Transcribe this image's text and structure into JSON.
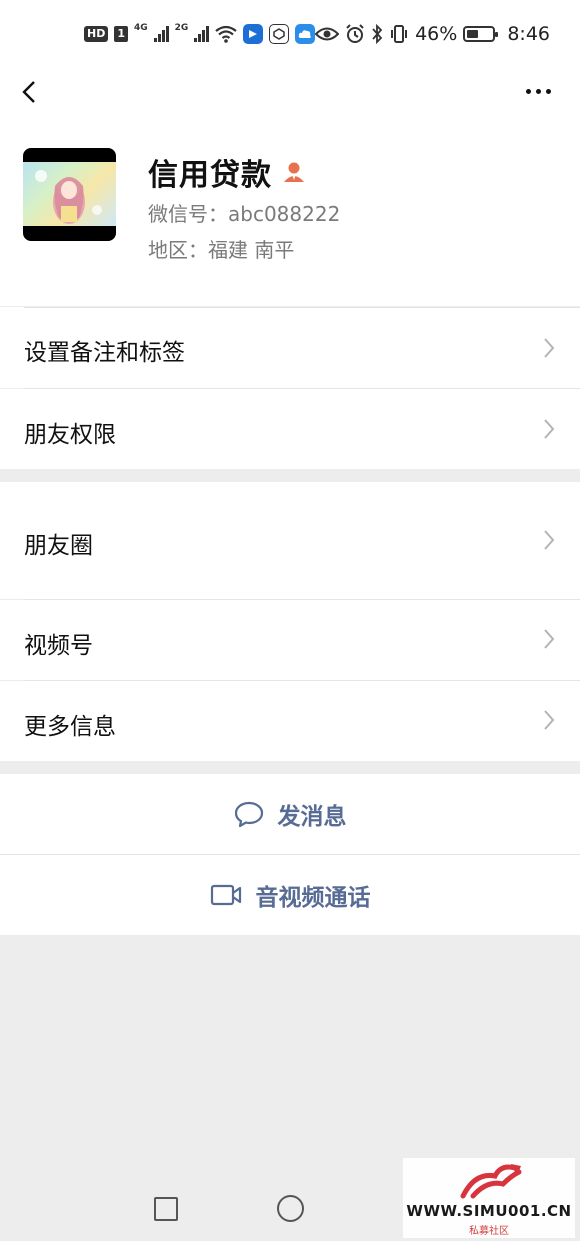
{
  "status_bar": {
    "hd": "HD",
    "sim": "1",
    "net1": "4G",
    "net2": "2G",
    "battery_pct": "46%",
    "time": "8:46",
    "battery_level": 0.46
  },
  "nav": {
    "back_icon": "chevron-left-icon",
    "more_icon": "more-dots-icon"
  },
  "profile": {
    "name": "信用贷款",
    "wechat_id": "微信号：abc088222",
    "region": "地区：福建  南平",
    "badge_icon": "person-badge-icon",
    "badge_color": "#e8714f"
  },
  "menu": {
    "remark_tags": "设置备注和标签",
    "permissions": "朋友权限",
    "moments": "朋友圈",
    "channels": "视频号",
    "more_info": "更多信息"
  },
  "actions": {
    "message": "发消息",
    "call": "音视频通话",
    "accent": "#576b95"
  },
  "watermark": {
    "site": "WWW.SIMU001.CN",
    "sub": "私募社区"
  }
}
